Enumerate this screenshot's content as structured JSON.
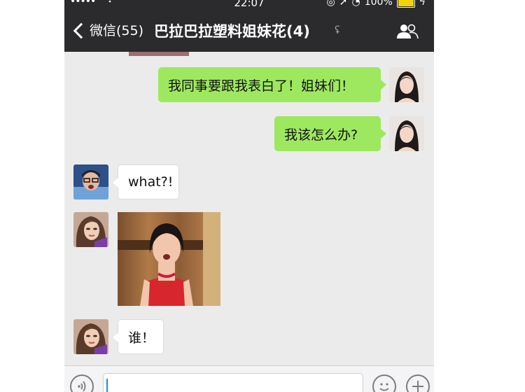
{
  "status_bar": {
    "signal": "•••••",
    "time": "22:07",
    "battery_percent": "100%",
    "battery_color": "#f2d20f",
    "icons": [
      "signal-dots-icon",
      "wifi-icon",
      "lock-rotation-icon",
      "location-arrow-icon",
      "alarm-icon",
      "battery-icon",
      "charging-bolt-icon"
    ]
  },
  "navbar": {
    "back_label": "微信(55)",
    "title": "巴拉巴拉塑料姐妹花(4)",
    "icons": [
      "chevron-left-icon",
      "ear-icon",
      "contacts-icon"
    ],
    "background": "#2b2b2e"
  },
  "messages": [
    {
      "side": "right",
      "type": "text",
      "text": "我同事要跟我表白了！姐妹们！",
      "avatar": "avatar-self"
    },
    {
      "side": "right",
      "type": "text",
      "text": "我该怎么办?",
      "avatar": "avatar-self"
    },
    {
      "side": "left",
      "type": "text",
      "text": "what?!",
      "avatar": "avatar-friend-a"
    },
    {
      "side": "left",
      "type": "image",
      "description_icon": "red-dress-photo",
      "avatar": "avatar-friend-b"
    },
    {
      "side": "left",
      "type": "text",
      "text": "谁！",
      "avatar": "avatar-friend-b"
    }
  ],
  "colors": {
    "sent_bubble": "#9ee860",
    "received_bubble": "#ffffff",
    "chat_background": "#ebebeb"
  },
  "input_bar": {
    "value": "",
    "icons": [
      "voice-icon",
      "emoji-icon",
      "plus-icon"
    ]
  }
}
